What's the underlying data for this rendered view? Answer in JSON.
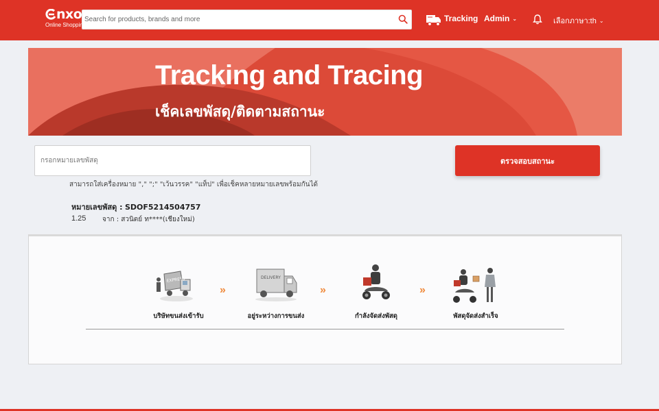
{
  "header": {
    "logo_main": "nxon",
    "logo_sub": "Online Shopping",
    "search_placeholder": "Search for products, brands and more",
    "tracking_label": "Tracking",
    "admin_label": "Admin",
    "language_label": "เลือกภาษา:th",
    "icons": [
      "search-icon",
      "truck-icon",
      "bell-icon",
      "chevron-down-icon"
    ]
  },
  "banner": {
    "title": "Tracking and Tracing",
    "subtitle": "เช็คเลขพัสดุ/ติดตามสถานะ"
  },
  "tracking": {
    "input_placeholder": "กรอกหมายเลขพัสดุ",
    "button_label": "ตรวจสอบสถานะ",
    "hint": "สามารถใส่เครื่องหมาย \",\" \";\" \"เว้นวรรค\" \"แท็ป\" เพื่อเช็คหลายหมายเลขพร้อมกันได้"
  },
  "result": {
    "label": "หมายเลขพัสดุ :",
    "number": "SDOF5214504757",
    "time": "1.25",
    "from": "จาก : สวนิตย์ ท****(เชียงใหม่)"
  },
  "steps": [
    {
      "label": "บริษัทขนส่งเข้ารับ",
      "icon": "express-truck-icon"
    },
    {
      "label": "อยู่ระหว่างการขนส่ง",
      "icon": "delivery-truck-icon"
    },
    {
      "label": "กำลังจัดส่งพัสดุ",
      "icon": "scooter-rider-icon"
    },
    {
      "label": "พัสดุจัดส่งสำเร็จ",
      "icon": "parcel-handover-icon"
    }
  ],
  "step_arrow": "»",
  "colors": {
    "brand": "#de3326",
    "arrow": "#f08a3c",
    "background": "#eef0f4"
  }
}
